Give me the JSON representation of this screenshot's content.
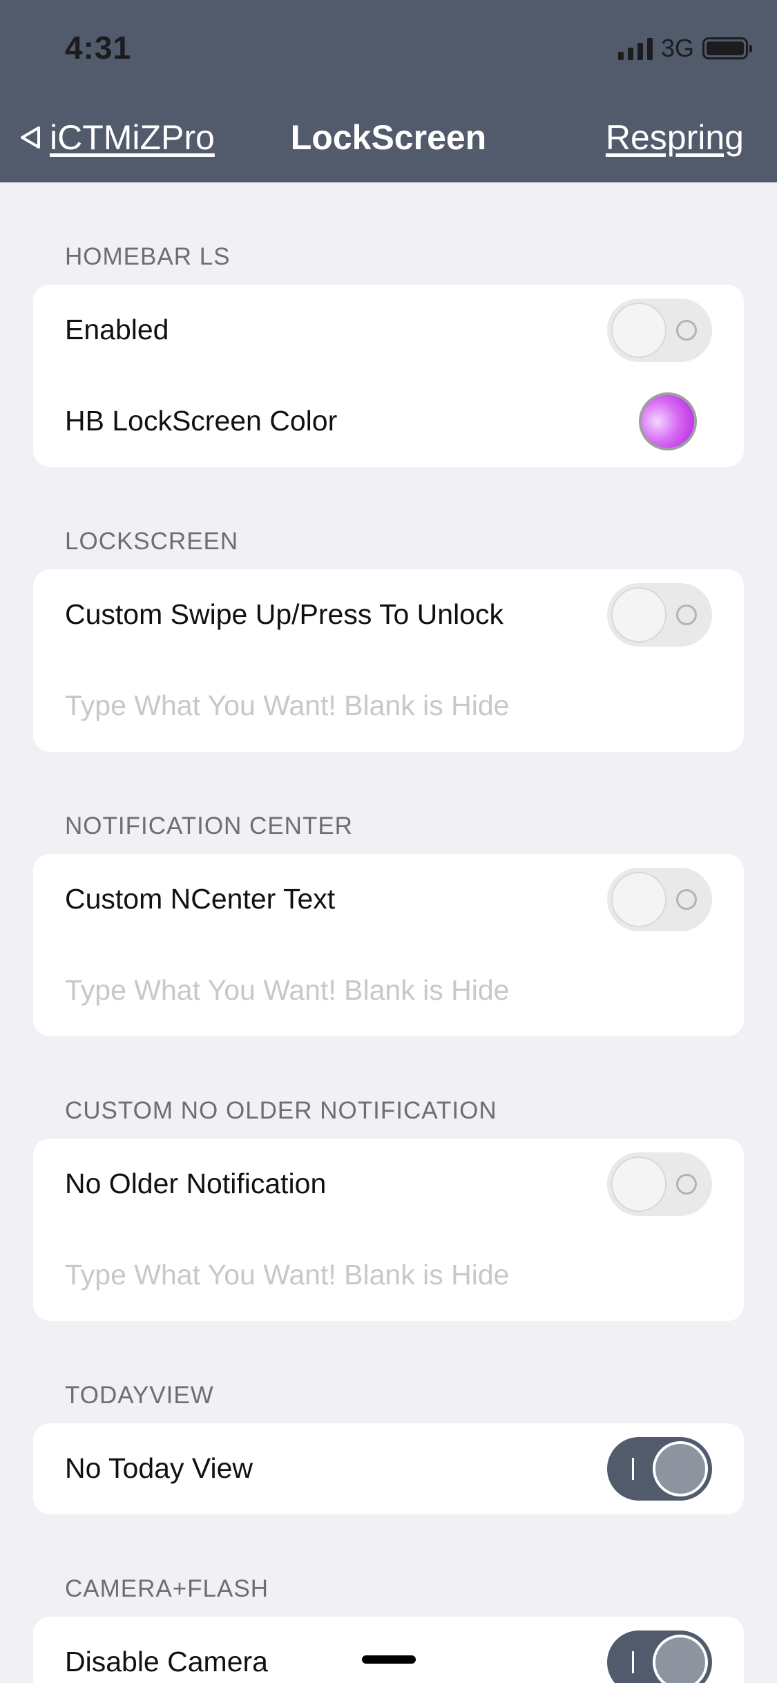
{
  "status_bar": {
    "time": "4:31",
    "network": "3G"
  },
  "nav": {
    "back_label": "iCTMiZPro",
    "title": "LockScreen",
    "action_label": "Respring"
  },
  "sections": {
    "homebar": {
      "header": "HOMEBAR LS",
      "enabled_label": "Enabled",
      "enabled_on": false,
      "color_label": "HB LockScreen Color",
      "color_value": "#D86CF3"
    },
    "lockscreen": {
      "header": "LOCKSCREEN",
      "toggle_label": "Custom Swipe Up/Press To Unlock",
      "toggle_on": false,
      "input_placeholder": "Type What You Want! Blank is Hide"
    },
    "notification_center": {
      "header": "NOTIFICATION CENTER",
      "toggle_label": "Custom NCenter Text",
      "toggle_on": false,
      "input_placeholder": "Type What You Want! Blank is Hide"
    },
    "no_older": {
      "header": "CUSTOM NO OLDER NOTIFICATION",
      "toggle_label": "No Older Notification",
      "toggle_on": false,
      "input_placeholder": "Type What You Want! Blank is Hide"
    },
    "todayview": {
      "header": "TODAYVIEW",
      "toggle_label": "No Today View",
      "toggle_on": true
    },
    "camera_flash": {
      "header": "CAMERA+FLASH",
      "toggle_label": "Disable Camera",
      "toggle_on": true
    }
  },
  "colors": {
    "nav_background": "#515B6C",
    "page_background": "#F0F0F5",
    "toggle_on": "#515B6C"
  }
}
